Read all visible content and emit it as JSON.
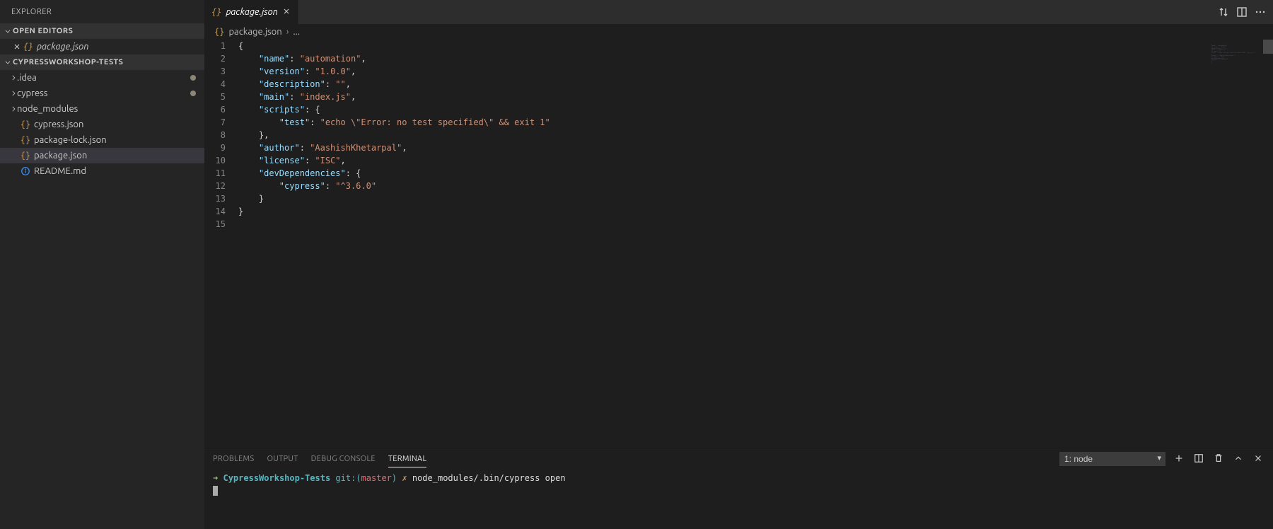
{
  "explorer": {
    "title": "EXPLORER"
  },
  "open_editors": {
    "header": "OPEN EDITORS",
    "items": [
      {
        "name": "package.json",
        "icon": "json"
      }
    ]
  },
  "workspace": {
    "header": "CYPRESSWORKSHOP-TESTS",
    "tree": [
      {
        "name": ".idea",
        "type": "folder",
        "modified": true
      },
      {
        "name": "cypress",
        "type": "folder",
        "modified": true
      },
      {
        "name": "node_modules",
        "type": "folder",
        "modified": false
      },
      {
        "name": "cypress.json",
        "type": "file",
        "icon": "json"
      },
      {
        "name": "package-lock.json",
        "type": "file",
        "icon": "json"
      },
      {
        "name": "package.json",
        "type": "file",
        "icon": "json",
        "selected": true
      },
      {
        "name": "README.md",
        "type": "file",
        "icon": "info"
      }
    ]
  },
  "tab": {
    "name": "package.json",
    "breadcrumb_file": "package.json",
    "breadcrumb_trail": "..."
  },
  "editor": {
    "line_count": 15,
    "lines": [
      [
        {
          "t": "p",
          "v": "{"
        }
      ],
      [
        {
          "t": "pad",
          "v": "    "
        },
        {
          "t": "k",
          "v": "\"name\""
        },
        {
          "t": "p",
          "v": ": "
        },
        {
          "t": "s",
          "v": "\"automation\""
        },
        {
          "t": "p",
          "v": ","
        }
      ],
      [
        {
          "t": "pad",
          "v": "    "
        },
        {
          "t": "k",
          "v": "\"version\""
        },
        {
          "t": "p",
          "v": ": "
        },
        {
          "t": "s",
          "v": "\"1.0.0\""
        },
        {
          "t": "p",
          "v": ","
        }
      ],
      [
        {
          "t": "pad",
          "v": "    "
        },
        {
          "t": "k",
          "v": "\"description\""
        },
        {
          "t": "p",
          "v": ": "
        },
        {
          "t": "s",
          "v": "\"\""
        },
        {
          "t": "p",
          "v": ","
        }
      ],
      [
        {
          "t": "pad",
          "v": "    "
        },
        {
          "t": "k",
          "v": "\"main\""
        },
        {
          "t": "p",
          "v": ": "
        },
        {
          "t": "s",
          "v": "\"index.js\""
        },
        {
          "t": "p",
          "v": ","
        }
      ],
      [
        {
          "t": "pad",
          "v": "    "
        },
        {
          "t": "k",
          "v": "\"scripts\""
        },
        {
          "t": "p",
          "v": ": {"
        }
      ],
      [
        {
          "t": "pad",
          "v": "        "
        },
        {
          "t": "k",
          "v": "\"test\""
        },
        {
          "t": "p",
          "v": ": "
        },
        {
          "t": "s",
          "v": "\"echo \\\"Error: no test specified\\\" && exit 1\""
        }
      ],
      [
        {
          "t": "pad",
          "v": "    "
        },
        {
          "t": "p",
          "v": "},"
        }
      ],
      [
        {
          "t": "pad",
          "v": "    "
        },
        {
          "t": "k",
          "v": "\"author\""
        },
        {
          "t": "p",
          "v": ": "
        },
        {
          "t": "s",
          "v": "\"AashishKhetarpal\""
        },
        {
          "t": "p",
          "v": ","
        }
      ],
      [
        {
          "t": "pad",
          "v": "    "
        },
        {
          "t": "k",
          "v": "\"license\""
        },
        {
          "t": "p",
          "v": ": "
        },
        {
          "t": "s",
          "v": "\"ISC\""
        },
        {
          "t": "p",
          "v": ","
        }
      ],
      [
        {
          "t": "pad",
          "v": "    "
        },
        {
          "t": "k",
          "v": "\"devDependencies\""
        },
        {
          "t": "p",
          "v": ": {"
        }
      ],
      [
        {
          "t": "pad",
          "v": "        "
        },
        {
          "t": "k",
          "v": "\"cypress\""
        },
        {
          "t": "p",
          "v": ": "
        },
        {
          "t": "s",
          "v": "\"^3.6.0\""
        }
      ],
      [
        {
          "t": "pad",
          "v": "    "
        },
        {
          "t": "p",
          "v": "}"
        }
      ],
      [
        {
          "t": "p",
          "v": "}"
        }
      ],
      []
    ]
  },
  "panel": {
    "tabs": {
      "problems": "PROBLEMS",
      "output": "OUTPUT",
      "debug": "DEBUG CONSOLE",
      "terminal": "TERMINAL"
    },
    "terminal_selector": "1: node",
    "line": {
      "arrow": "➜",
      "path": "CypressWorkshop-Tests",
      "gitlabel": "git:(",
      "branch": "master",
      "gitclose": ")",
      "dirty": "✗",
      "command": "node_modules/.bin/cypress open"
    }
  }
}
